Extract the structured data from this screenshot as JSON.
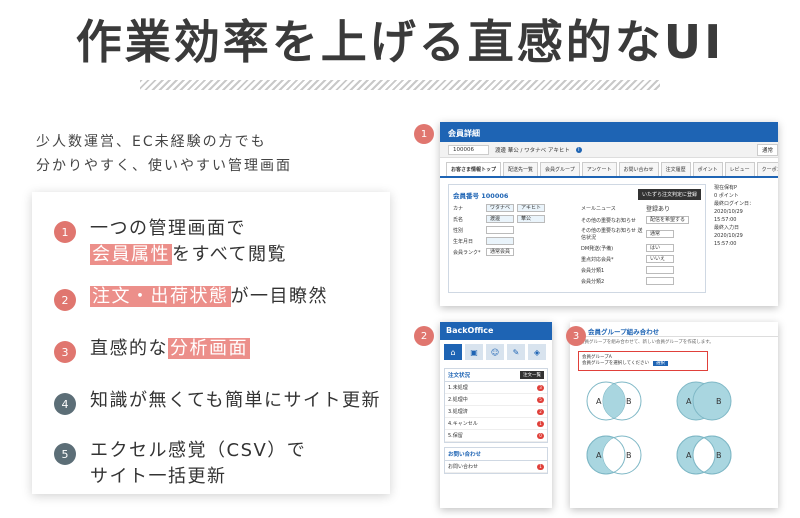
{
  "heading": "作業効率を上げる直感的なUI",
  "intro": [
    "少人数運営、EC未経験の方でも",
    "分かりやすく、使いやすい管理画面"
  ],
  "features": [
    {
      "num": "1",
      "l1a": "一つの管理画面で",
      "l2hl": "会員属性",
      "l2b": "をすべて閲覧"
    },
    {
      "num": "2",
      "hl": "注文・出荷状態",
      "after": "が一目瞭然"
    },
    {
      "num": "3",
      "before": "直感的な",
      "hl": "分析画面"
    },
    {
      "num": "4",
      "text": "知識が無くても簡単にサイト更新"
    },
    {
      "num": "5",
      "l1": "エクセル感覚（CSV）で",
      "l2": "サイト一括更新"
    }
  ],
  "shot1": {
    "badge": "1",
    "title": "会員詳細",
    "id_value": "100006",
    "name_line": "渡邊 華公 / ワタナベ アキヒト",
    "info_icon": "i",
    "back_label": "通常",
    "tabs": [
      "お客さま情報トップ",
      "配送先一覧",
      "会員グループ",
      "アンケート",
      "お問い合わせ",
      "注文履歴",
      "ポイント",
      "レビュー",
      "クーポン"
    ],
    "form_title": "会員番号 100006",
    "action_label": "いたずら注文判定に登録",
    "left_fields": [
      {
        "label": "カナ",
        "v1": "ワタナベ",
        "v2": "アキヒト"
      },
      {
        "label": "氏名",
        "v1": "渡邊",
        "v2": "華公"
      },
      {
        "label": "性別",
        "v1": "",
        "v2": ""
      },
      {
        "label": "生年月日",
        "v1": "",
        "v2": ""
      },
      {
        "label": "会員ランク*",
        "v1": "通常会員",
        "v2": ""
      }
    ],
    "right_fields": [
      {
        "label": "メールニュース",
        "value": "登録あり"
      },
      {
        "label": "その他の重要なお知らせ",
        "value": "配信を希望する"
      },
      {
        "label": "その他の重要なお知らせ 送信状況",
        "value": "通常"
      },
      {
        "label": "DM発送(予備)",
        "value": "はい"
      },
      {
        "label": "重点対応会員*",
        "value": "いいえ"
      },
      {
        "label": "会員分類1",
        "value": ""
      },
      {
        "label": "会員分類2",
        "value": ""
      }
    ],
    "side": [
      "現在保有P",
      "0 ポイント",
      "",
      "最終ログイン日：",
      "2020/10/29",
      "15:57:00",
      "",
      "最終入力日",
      "2020/10/29",
      "15:57:00"
    ]
  },
  "shot2": {
    "badge": "2",
    "title": "BackOffice",
    "panel_title": "注文状況",
    "panel_button": "注文一覧",
    "items": [
      {
        "label": "1.未処理",
        "c1": "3"
      },
      {
        "label": "2.処理中",
        "c1": "5"
      },
      {
        "label": "3.処理済",
        "c1": "2"
      },
      {
        "label": "4.キャンセル",
        "c1": "1"
      },
      {
        "label": "5.保留",
        "c1": "0"
      }
    ],
    "panel2_title": "お問い合わせ",
    "panel2_item": "お問い合わせ",
    "panel2_count": "1"
  },
  "shot3": {
    "badge": "3",
    "title": "会員グループ組み合わせ",
    "desc": "会員グループを組み合わせて、新しい会員グループを作成します。",
    "box_title": "会員グループA",
    "box_select": "会員グループを選択してください",
    "box_button": "選択",
    "venn_a": "A",
    "venn_b": "B"
  },
  "colors": {
    "accent_red": "#e0766f",
    "highlight": "#ec8f8a",
    "gray_num": "#5c6e77",
    "brand_blue": "#1e64b4",
    "venn_fill": "#a9d6e0"
  }
}
